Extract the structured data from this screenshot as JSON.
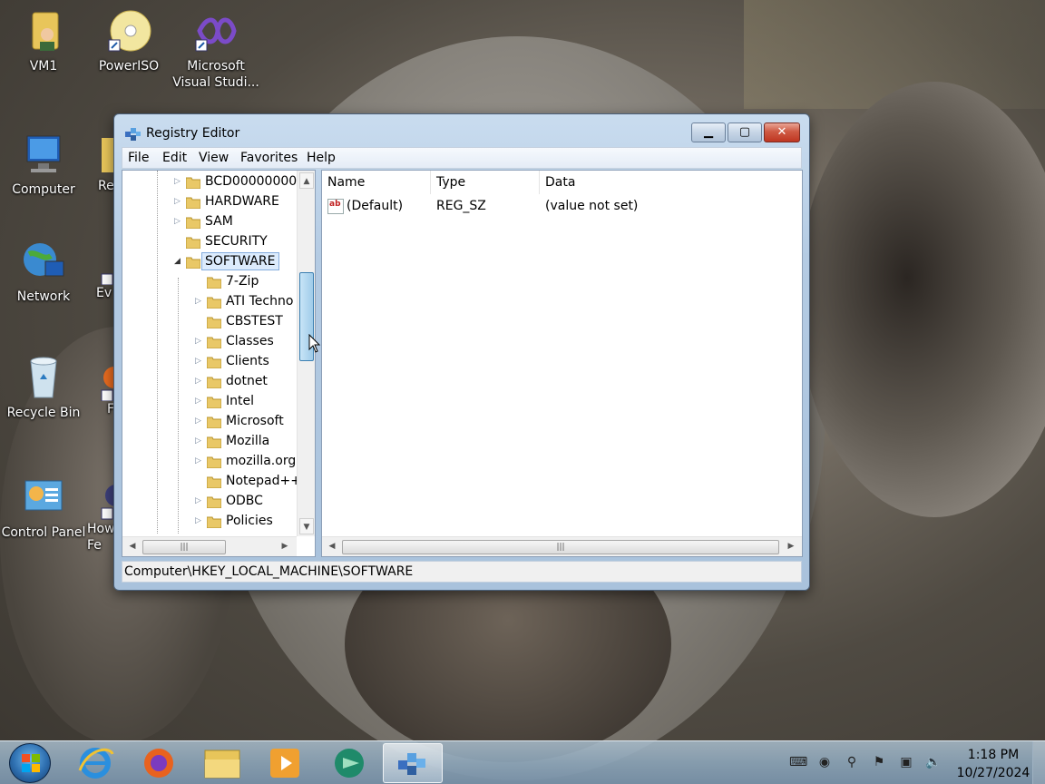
{
  "desktop": {
    "icons": [
      {
        "label": "VM1",
        "icon": "user-folder-icon"
      },
      {
        "label": "PowerISO",
        "icon": "disc-icon"
      },
      {
        "label": "Microsoft Visual Studi...",
        "icon": "visual-studio-icon"
      },
      {
        "label": "Computer",
        "icon": "computer-icon"
      },
      {
        "label": "Re",
        "icon": "folder-icon"
      },
      {
        "label": "Network",
        "icon": "network-icon"
      },
      {
        "label": "Ev",
        "icon": "shortcut-icon"
      },
      {
        "label": "Recycle Bin",
        "icon": "recycle-bin-icon"
      },
      {
        "label": "F",
        "icon": "shortcut-icon"
      },
      {
        "label": "Control Panel",
        "icon": "control-panel-icon"
      },
      {
        "label": "How Fe",
        "icon": "shortcut-icon"
      }
    ]
  },
  "window": {
    "title": "Registry Editor",
    "menu": [
      "File",
      "Edit",
      "View",
      "Favorites",
      "Help"
    ],
    "tree": {
      "root_items": [
        {
          "label": "BCD00000000",
          "expandable": true
        },
        {
          "label": "HARDWARE",
          "expandable": true
        },
        {
          "label": "SAM",
          "expandable": true
        },
        {
          "label": "SECURITY",
          "expandable": false
        },
        {
          "label": "SOFTWARE",
          "expandable": true,
          "expanded": true,
          "selected": true
        }
      ],
      "child_items": [
        {
          "label": "7-Zip",
          "expandable": false
        },
        {
          "label": "ATI Techno",
          "expandable": true
        },
        {
          "label": "CBSTEST",
          "expandable": false
        },
        {
          "label": "Classes",
          "expandable": true
        },
        {
          "label": "Clients",
          "expandable": true
        },
        {
          "label": "dotnet",
          "expandable": true
        },
        {
          "label": "Intel",
          "expandable": true
        },
        {
          "label": "Microsoft",
          "expandable": true
        },
        {
          "label": "Mozilla",
          "expandable": true
        },
        {
          "label": "mozilla.org",
          "expandable": true
        },
        {
          "label": "Notepad++",
          "expandable": false
        },
        {
          "label": "ODBC",
          "expandable": true
        },
        {
          "label": "Policies",
          "expandable": true
        }
      ]
    },
    "list": {
      "columns": [
        "Name",
        "Type",
        "Data"
      ],
      "rows": [
        {
          "name": "(Default)",
          "type": "REG_SZ",
          "data": "(value not set)"
        }
      ]
    },
    "status": "Computer\\HKEY_LOCAL_MACHINE\\SOFTWARE"
  },
  "taskbar": {
    "pinned": [
      "internet-explorer-icon",
      "firefox-icon",
      "file-explorer-icon",
      "media-player-icon",
      "chat-icon",
      "registry-editor-icon"
    ],
    "clock_time": "1:18 PM",
    "clock_date": "10/27/2024"
  }
}
